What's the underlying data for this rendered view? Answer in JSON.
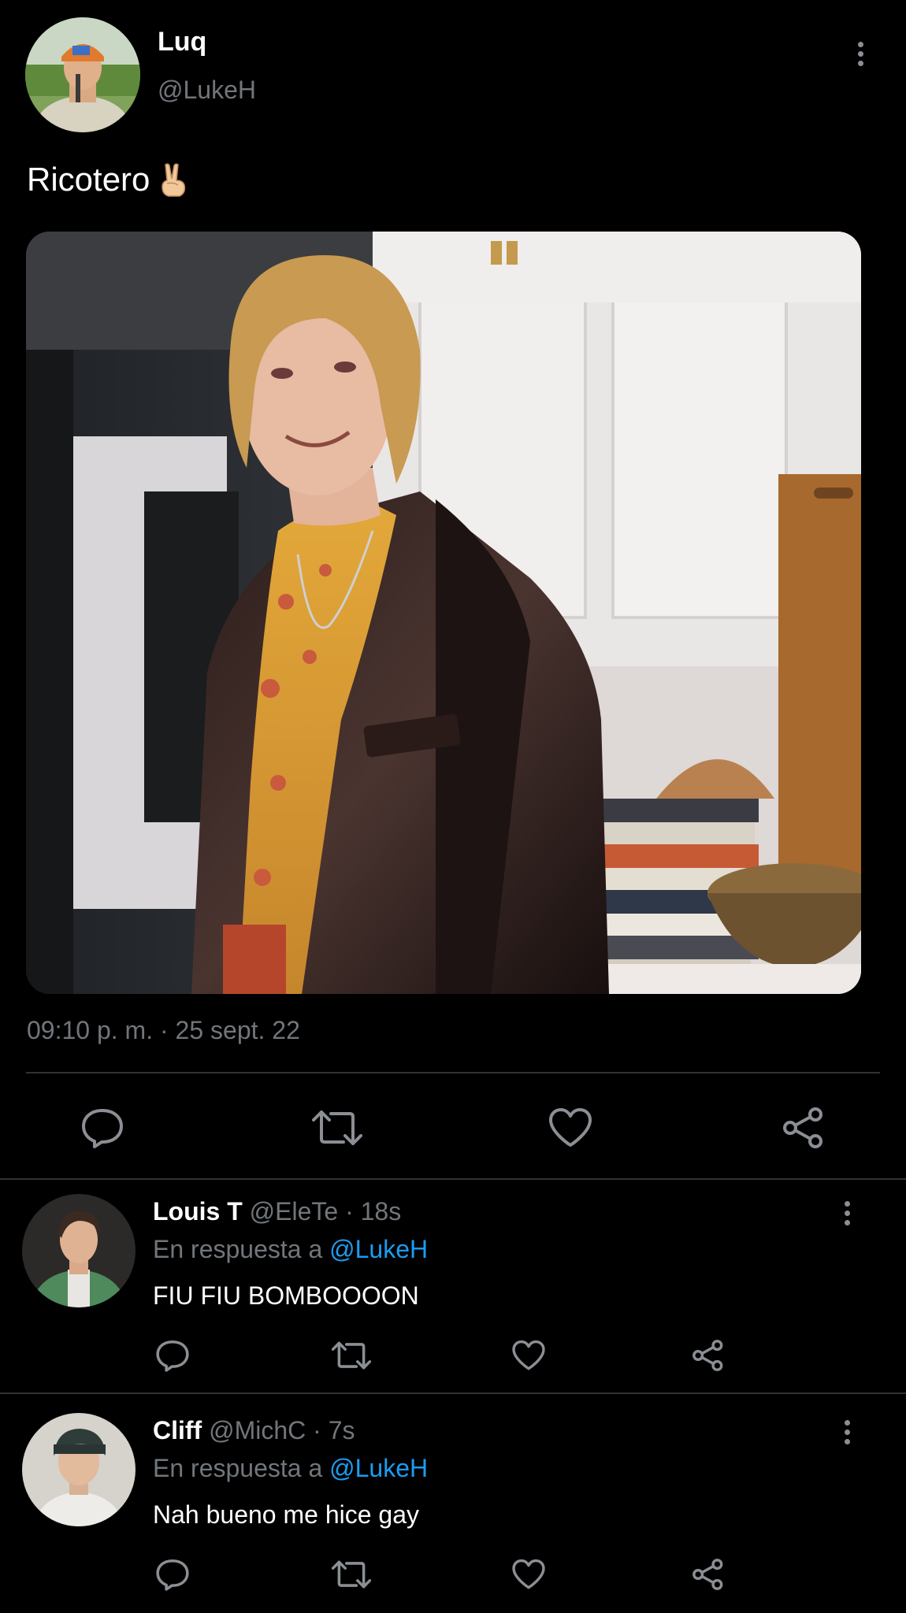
{
  "tweet": {
    "author_name": "Luq",
    "author_handle": "@LukeH",
    "text": "Ricotero",
    "emoji": "victory-hand",
    "timestamp": "09:10 p. m. · 25 sept. 22",
    "actions": [
      "reply-icon",
      "retweet-icon",
      "like-icon",
      "share-icon"
    ]
  },
  "replies": [
    {
      "name": "Louis T",
      "handle": "@EleTe",
      "sep": "·",
      "time": "18s",
      "reply_prefix": "En respuesta a",
      "reply_to": "@LukeH",
      "text": "FIU FIU BOMBOOOON"
    },
    {
      "name": "Cliff",
      "handle": "@MichC",
      "sep": "·",
      "time": "7s",
      "reply_prefix": "En respuesta a",
      "reply_to": "@LukeH",
      "text": "Nah bueno me hice gay"
    }
  ],
  "colors": {
    "background": "#000000",
    "text": "#ffffff",
    "secondary": "#71767b",
    "link": "#1d9bf0",
    "divider": "#2f3336"
  }
}
